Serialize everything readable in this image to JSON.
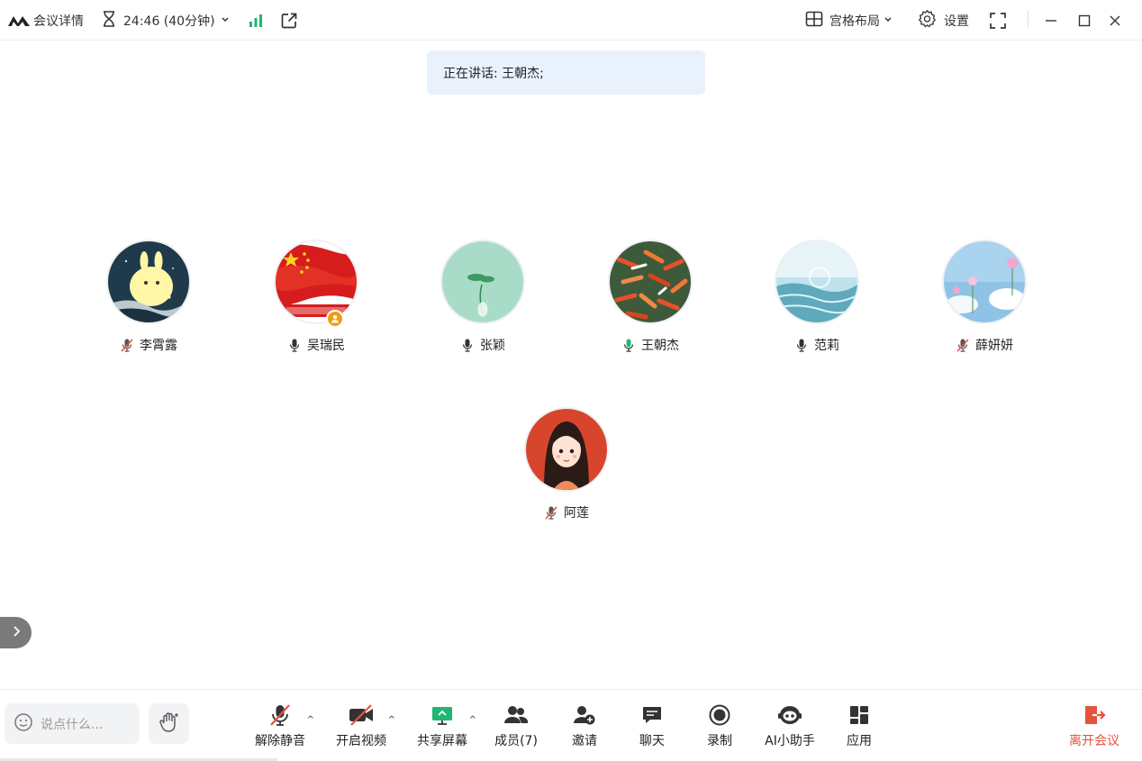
{
  "titlebar": {
    "meeting_details": "会议详情",
    "timer": "24:46 (40分钟)",
    "layout": "宫格布局",
    "settings": "设置"
  },
  "speaker_banner": {
    "text": "正在讲话: 王朝杰;"
  },
  "participants": [
    {
      "name": "李霄露",
      "mic": "muted"
    },
    {
      "name": "吴瑞民",
      "mic": "on",
      "host": true
    },
    {
      "name": "张颖",
      "mic": "on"
    },
    {
      "name": "王朝杰",
      "mic": "speaking"
    },
    {
      "name": "范莉",
      "mic": "on"
    },
    {
      "name": "薛妍妍",
      "mic": "muted"
    },
    {
      "name": "阿莲",
      "mic": "muted"
    }
  ],
  "toolbar": {
    "chat_placeholder": "说点什么...",
    "unmute": "解除静音",
    "start_video": "开启视频",
    "share_screen": "共享屏幕",
    "members": "成员(7)",
    "invite": "邀请",
    "chat": "聊天",
    "record": "录制",
    "ai_assistant": "AI小助手",
    "apps": "应用",
    "leave": "离开会议"
  },
  "colors": {
    "accent_green": "#22b573",
    "leave_red": "#e5533d",
    "muted_red": "#e5533d",
    "banner_bg": "#e9f1fd"
  }
}
